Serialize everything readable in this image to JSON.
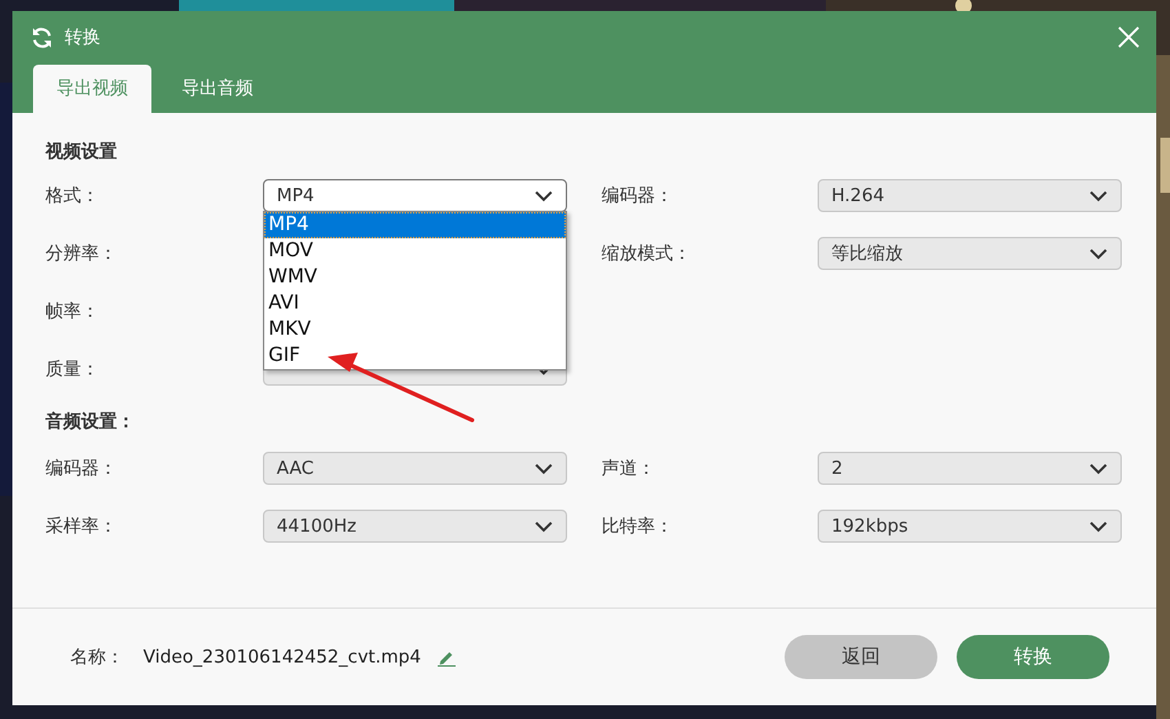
{
  "window": {
    "title": "转换"
  },
  "tabs": [
    {
      "label": "导出视频",
      "selected": true
    },
    {
      "label": "导出音频",
      "selected": false
    }
  ],
  "sections": [
    {
      "title": "视频设置",
      "rows": [
        {
          "fields": [
            {
              "label": "格式：",
              "select": {
                "value": "MP4",
                "open": true,
                "options": [
                  {
                    "label": "MP4",
                    "selected": true
                  },
                  {
                    "label": "MOV",
                    "selected": false
                  },
                  {
                    "label": "WMV",
                    "selected": false
                  },
                  {
                    "label": "AVI",
                    "selected": false
                  },
                  {
                    "label": "MKV",
                    "selected": false
                  },
                  {
                    "label": "GIF",
                    "selected": false
                  }
                ]
              }
            },
            {
              "label": "编码器：",
              "select": {
                "value": "H.264",
                "open": false
              }
            }
          ]
        },
        {
          "fields": [
            {
              "label": "分辨率："
            },
            {
              "label": "缩放模式：",
              "select": {
                "value": "等比缩放",
                "open": false
              }
            }
          ]
        },
        {
          "fields": [
            {
              "label": "帧率："
            }
          ]
        },
        {
          "fields": [
            {
              "label": "质量：",
              "select": {
                "open": false
              }
            }
          ]
        }
      ]
    },
    {
      "title": "音频设置：",
      "rows": [
        {
          "fields": [
            {
              "label": "编码器：",
              "select": {
                "value": "AAC",
                "open": false
              }
            },
            {
              "label": "声道：",
              "select": {
                "value": "2",
                "open": false
              }
            }
          ]
        },
        {
          "fields": [
            {
              "label": "采样率：",
              "select": {
                "value": "44100Hz",
                "open": false
              }
            },
            {
              "label": "比特率：",
              "select": {
                "value": "192kbps",
                "open": false
              }
            }
          ]
        }
      ]
    }
  ],
  "footer": {
    "name_label": "名称：",
    "file_name": "Video_230106142452_cvt.mp4",
    "buttons": [
      {
        "label": "返回",
        "kind": "secondary"
      },
      {
        "label": "转换",
        "kind": "primary"
      }
    ]
  }
}
